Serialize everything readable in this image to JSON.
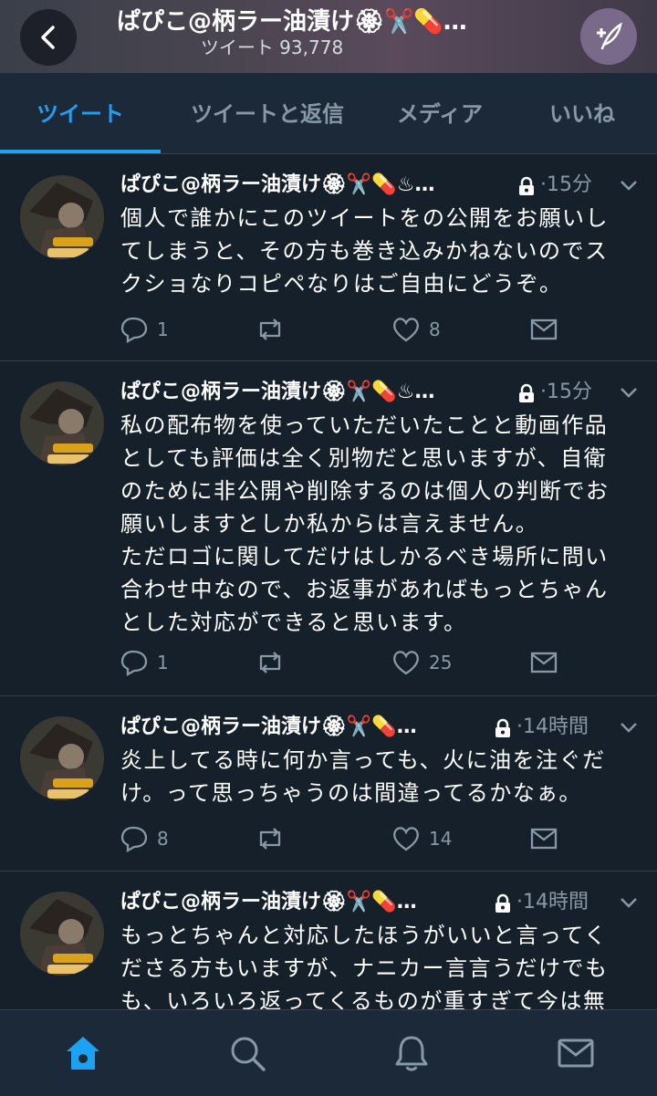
{
  "header": {
    "title": "ぱぴこ@柄ラー油漬け🏵✂️💊…",
    "tweet_count": "ツイート 93,778"
  },
  "tabs": [
    {
      "label": "ツイート",
      "active": true
    },
    {
      "label": "ツイートと返信",
      "active": false
    },
    {
      "label": "メディア",
      "active": false
    },
    {
      "label": "いいね",
      "active": false
    }
  ],
  "tweets": [
    {
      "name": "ぱぴこ@柄ラー油漬け🏵✂️💊♨…",
      "time": "15分",
      "text": "個人で誰かにこのツイートをの公開をお願いし\nてしまうと、その方も巻き込みかねないのでス\nクショなりコピペなりはご自由にどうぞ。",
      "replies": "1",
      "retweets": "",
      "likes": "8"
    },
    {
      "name": "ぱぴこ@柄ラー油漬け🏵✂️💊♨…",
      "time": "15分",
      "text": "私の配布物を使っていただいたことと動画作品\nとしても評価は全く別物だと思いますが、自衛\nのために非公開や削除するのは個人の判断でお\n願いしますとしか私からは言えません。\nただロゴに関してだけはしかるべき場所に問い\n合わせ中なので、お返事があればもっとちゃん\nとした対応ができると思います。",
      "replies": "1",
      "retweets": "",
      "likes": "25"
    },
    {
      "name": "ぱぴこ@柄ラー油漬け🏵✂️💊…",
      "time": "14時間",
      "text": "炎上してる時に何か言っても、火に油を注ぐだ\nけ。って思っちゃうのは間違ってるかなぁ。",
      "replies": "8",
      "retweets": "",
      "likes": "14"
    },
    {
      "name": "ぱぴこ@柄ラー油漬け🏵✂️💊…",
      "time": "14時間",
      "text": "もっとちゃんと対応したほうがいいと言ってく\nださる方もいますが、ナニカー言言うだけでも\nも、いろいろ返ってくるものが重すぎて今は無",
      "replies": "",
      "retweets": "",
      "likes": ""
    }
  ],
  "avatar_badge": "Servant",
  "colors": {
    "background": "#15202b",
    "accent": "#1da1f2",
    "muted": "#8899a6",
    "divider": "#38444d"
  },
  "icons": [
    "back-arrow-icon",
    "compose-tweet-icon",
    "lock-icon",
    "chevron-down-icon",
    "reply-icon",
    "retweet-icon",
    "like-icon",
    "dm-icon",
    "home-icon",
    "search-icon",
    "notifications-icon",
    "messages-icon"
  ]
}
